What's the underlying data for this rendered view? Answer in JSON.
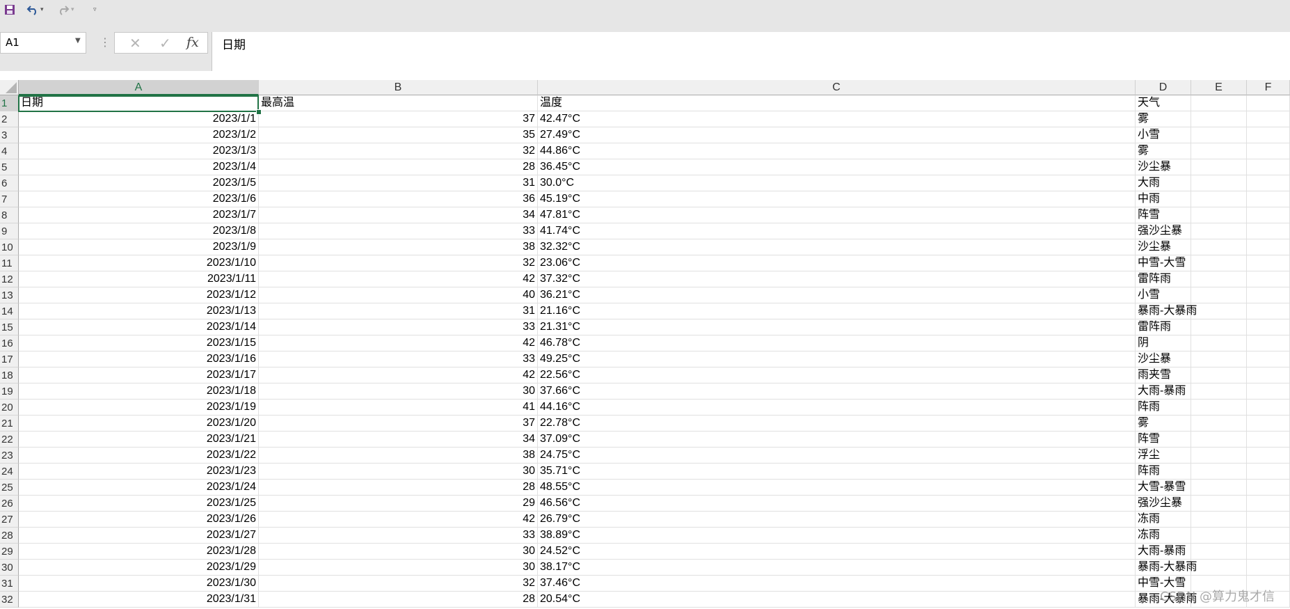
{
  "quick_access": {
    "icons": [
      "save-icon",
      "undo-icon",
      "redo-icon",
      "customize-toolbar-icon"
    ]
  },
  "formula_bar": {
    "name_box": "A1",
    "formula_value": "日期"
  },
  "columns": [
    {
      "letter": "A"
    },
    {
      "letter": "B"
    },
    {
      "letter": "C"
    },
    {
      "letter": "D"
    },
    {
      "letter": "E"
    },
    {
      "letter": "F"
    }
  ],
  "header_row": [
    "日期",
    "最高温",
    "温度",
    "天气"
  ],
  "rows": [
    {
      "date": "2023/1/1",
      "max": "37",
      "temp": "42.47°C",
      "weather": "雾"
    },
    {
      "date": "2023/1/2",
      "max": "35",
      "temp": "27.49°C",
      "weather": "小雪"
    },
    {
      "date": "2023/1/3",
      "max": "32",
      "temp": "44.86°C",
      "weather": "雾"
    },
    {
      "date": "2023/1/4",
      "max": "28",
      "temp": "36.45°C",
      "weather": "沙尘暴"
    },
    {
      "date": "2023/1/5",
      "max": "31",
      "temp": "30.0°C",
      "weather": "大雨"
    },
    {
      "date": "2023/1/6",
      "max": "36",
      "temp": "45.19°C",
      "weather": "中雨"
    },
    {
      "date": "2023/1/7",
      "max": "34",
      "temp": "47.81°C",
      "weather": "阵雪"
    },
    {
      "date": "2023/1/8",
      "max": "33",
      "temp": "41.74°C",
      "weather": "强沙尘暴"
    },
    {
      "date": "2023/1/9",
      "max": "38",
      "temp": "32.32°C",
      "weather": "沙尘暴"
    },
    {
      "date": "2023/1/10",
      "max": "32",
      "temp": "23.06°C",
      "weather": "中雪-大雪"
    },
    {
      "date": "2023/1/11",
      "max": "42",
      "temp": "37.32°C",
      "weather": "雷阵雨"
    },
    {
      "date": "2023/1/12",
      "max": "40",
      "temp": "36.21°C",
      "weather": "小雪"
    },
    {
      "date": "2023/1/13",
      "max": "31",
      "temp": "21.16°C",
      "weather": "暴雨-大暴雨"
    },
    {
      "date": "2023/1/14",
      "max": "33",
      "temp": "21.31°C",
      "weather": "雷阵雨"
    },
    {
      "date": "2023/1/15",
      "max": "42",
      "temp": "46.78°C",
      "weather": "阴"
    },
    {
      "date": "2023/1/16",
      "max": "33",
      "temp": "49.25°C",
      "weather": "沙尘暴"
    },
    {
      "date": "2023/1/17",
      "max": "42",
      "temp": "22.56°C",
      "weather": "雨夹雪"
    },
    {
      "date": "2023/1/18",
      "max": "30",
      "temp": "37.66°C",
      "weather": "大雨-暴雨"
    },
    {
      "date": "2023/1/19",
      "max": "41",
      "temp": "44.16°C",
      "weather": "阵雨"
    },
    {
      "date": "2023/1/20",
      "max": "37",
      "temp": "22.78°C",
      "weather": "雾"
    },
    {
      "date": "2023/1/21",
      "max": "34",
      "temp": "37.09°C",
      "weather": "阵雪"
    },
    {
      "date": "2023/1/22",
      "max": "38",
      "temp": "24.75°C",
      "weather": "浮尘"
    },
    {
      "date": "2023/1/23",
      "max": "30",
      "temp": "35.71°C",
      "weather": "阵雨"
    },
    {
      "date": "2023/1/24",
      "max": "28",
      "temp": "48.55°C",
      "weather": "大雪-暴雪"
    },
    {
      "date": "2023/1/25",
      "max": "29",
      "temp": "46.56°C",
      "weather": "强沙尘暴"
    },
    {
      "date": "2023/1/26",
      "max": "42",
      "temp": "26.79°C",
      "weather": "冻雨"
    },
    {
      "date": "2023/1/27",
      "max": "33",
      "temp": "38.89°C",
      "weather": "冻雨"
    },
    {
      "date": "2023/1/28",
      "max": "30",
      "temp": "24.52°C",
      "weather": "大雨-暴雨"
    },
    {
      "date": "2023/1/29",
      "max": "30",
      "temp": "38.17°C",
      "weather": "暴雨-大暴雨"
    },
    {
      "date": "2023/1/30",
      "max": "32",
      "temp": "37.46°C",
      "weather": "中雪-大雪"
    },
    {
      "date": "2023/1/31",
      "max": "28",
      "temp": "20.54°C",
      "weather": "暴雨-大暴雨"
    }
  ],
  "watermark": "CSDN @算力鬼才信",
  "colors": {
    "accent": "#217346",
    "save_icon": "#7a3b8f",
    "undo_icon": "#2b5797"
  }
}
